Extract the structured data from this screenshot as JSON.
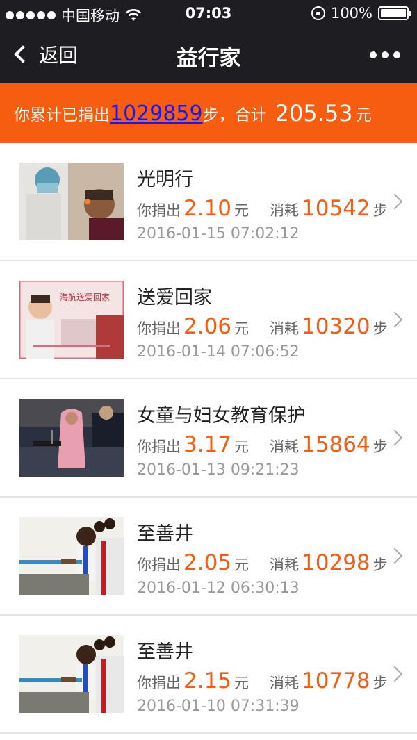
{
  "status_bar": {
    "carrier": "中国移动",
    "time": "07:03",
    "battery": "100%"
  },
  "nav": {
    "back_label": "返回",
    "title": "益行家"
  },
  "summary": {
    "prefix": "你累计已捐出",
    "steps": "1029859",
    "steps_unit": "步，合计",
    "amount": "205.53",
    "amount_unit": "元"
  },
  "labels": {
    "donated": "你捐出",
    "yuan": "元",
    "consumed": "消耗",
    "steps": "步"
  },
  "items": [
    {
      "title": "光明行",
      "amount": "2.10",
      "steps": "10542",
      "date": "2016-01-15 07:02:12",
      "thumb": "eye-exam-photo"
    },
    {
      "title": "送爱回家",
      "amount": "2.06",
      "steps": "10320",
      "date": "2016-01-14 07:06:52",
      "thumb": "home-trip-poster",
      "thumb_caption": "海航送爱回家"
    },
    {
      "title": "女童与妇女教育保护",
      "amount": "3.17",
      "steps": "15864",
      "date": "2016-01-13 09:21:23",
      "thumb": "speech-photo"
    },
    {
      "title": "至善井",
      "amount": "2.05",
      "steps": "10298",
      "date": "2016-01-12 06:30:13",
      "thumb": "children-water-photo"
    },
    {
      "title": "至善井",
      "amount": "2.15",
      "steps": "10778",
      "date": "2016-01-10 07:31:39",
      "thumb": "children-water-photo"
    }
  ],
  "colors": {
    "accent": "#f65d10",
    "header_bg": "#1e1e22",
    "link": "#1a1ae6"
  }
}
